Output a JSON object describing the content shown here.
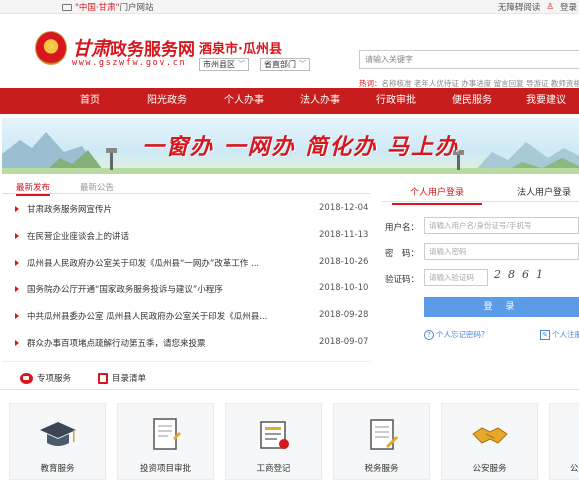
{
  "topbar": {
    "portal_prefix": "\"中国·甘肃\"",
    "portal_suffix": "门户网站",
    "accessible": "无障碍阅读",
    "login": "登录"
  },
  "header": {
    "brand_gs": "甘肃",
    "brand_title": "政务服务网",
    "domain": "www.gszwfw.gov.cn",
    "region": "酒泉市·瓜州县",
    "region_select": "市州县区",
    "dept_select": "省直部门",
    "search_placeholder": "请输入关键字",
    "hot_label": "热词：",
    "hot_words": "名称核准 老年人优待证 办事进度 留言回复 导游证 教师资格"
  },
  "nav": [
    "首页",
    "阳光政务",
    "个人办事",
    "法人办事",
    "行政审批",
    "便民服务",
    "我要建议"
  ],
  "banner": {
    "slogan": "一窗办  一网办  简化办  马上办"
  },
  "news": {
    "tab_active": "最新发布",
    "tab_inactive": "最新公告",
    "items": [
      {
        "title": "甘肃政务服务网宣传片",
        "date": "2018-12-04"
      },
      {
        "title": "在民营企业座谈会上的讲话",
        "date": "2018-11-13"
      },
      {
        "title": "瓜州县人民政府办公室关于印发《瓜州县“一网办”改革工作 ...",
        "date": "2018-10-26"
      },
      {
        "title": "国务院办公厅开通“国家政务服务投诉与建议”小程序",
        "date": "2018-10-10"
      },
      {
        "title": "中共瓜州县委办公室 瓜州县人民政府办公室关于印发《瓜州县...",
        "date": "2018-09-28"
      },
      {
        "title": "群众办事百项堵点疏解行动第五季，请您来投票",
        "date": "2018-09-07"
      }
    ]
  },
  "login": {
    "tab_personal": "个人用户登录",
    "tab_corporate": "法人用户登录",
    "username_label": "用户名：",
    "username_placeholder": "请输入用户名/身份证号/手机号",
    "password_label": "密　码：",
    "password_placeholder": "请输入密码",
    "captcha_label": "验证码：",
    "captcha_placeholder": "请输入验证码",
    "captcha_text": "2861",
    "submit": "登 录",
    "forgot": "个人忘记密码？",
    "register": "个人注册"
  },
  "services_tabs": {
    "special": "专项服务",
    "catalog": "目录清单"
  },
  "tiles": [
    "教育服务",
    "投资项目审批",
    "工商登记",
    "税务服务",
    "公安服务",
    "公"
  ],
  "colors": {
    "brand_red": "#c81d1d",
    "link_blue": "#4a86d6",
    "button_blue": "#5b9be7"
  }
}
